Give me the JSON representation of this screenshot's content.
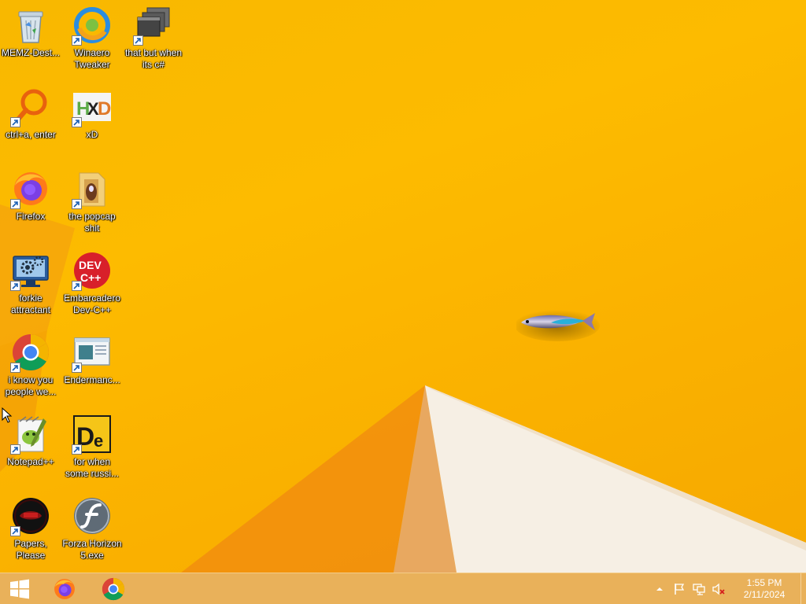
{
  "desktop": {
    "icons": [
      {
        "label": "MEMZ-Dest...",
        "icon": "recycle-bin-icon"
      },
      {
        "label": "Winaero Tweaker",
        "icon": "winaero-tweaker-icon"
      },
      {
        "label": "that but when its c#",
        "icon": "stacked-windows-icon"
      },
      {
        "label": "ctrl+a, enter",
        "icon": "magnifier-ring-icon"
      },
      {
        "label": "xD",
        "icon": "hxd-editor-icon"
      },
      {
        "label": "Firefox",
        "icon": "firefox-icon"
      },
      {
        "label": "the popcap shit",
        "icon": "folder-icon"
      },
      {
        "label": "forkie attractant",
        "icon": "settings-monitor-icon"
      },
      {
        "label": "Embarcadero Dev-C++",
        "icon": "devcpp-icon"
      },
      {
        "label": "i know you people we...",
        "icon": "chrome-icon"
      },
      {
        "label": "Endermanc...",
        "icon": "window-app-icon"
      },
      {
        "label": "Notepad++",
        "icon": "notepadpp-icon"
      },
      {
        "label": "for when some russi...",
        "icon": "de-logo-icon"
      },
      {
        "label": "Papers, Please",
        "icon": "papers-please-icon"
      },
      {
        "label": "Forza Horizon 5.exe",
        "icon": "flash-icon"
      }
    ]
  },
  "taskbar": {
    "start": "windows-logo-icon",
    "pinned": [
      {
        "name": "Firefox",
        "icon": "firefox-icon"
      },
      {
        "name": "Google Chrome",
        "icon": "chrome-icon"
      }
    ],
    "tray": {
      "icons": [
        "chevron-up-icon",
        "flag-icon",
        "network-icon",
        "speaker-muted-icon"
      ],
      "time": "1:55 PM",
      "date": "2/11/2024"
    }
  },
  "colors": {
    "wallpaper": "#fbb300",
    "taskbar": "#e9b15a",
    "label_text": "#ffffff"
  }
}
